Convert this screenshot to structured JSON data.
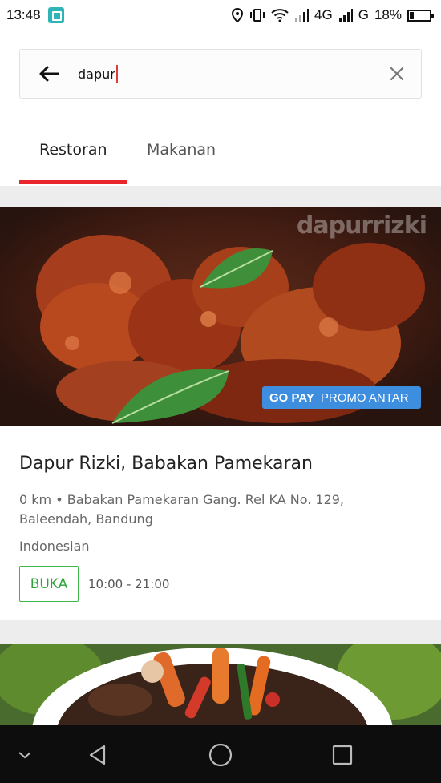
{
  "status_bar": {
    "time": "13:48",
    "network_1": "4G",
    "network_2": "G",
    "battery_percent": "18%",
    "battery_level": 0.18
  },
  "search": {
    "query": "dapur"
  },
  "tabs": [
    {
      "label": "Restoran",
      "active": true
    },
    {
      "label": "Makanan",
      "active": false
    }
  ],
  "results": [
    {
      "watermark": "dapurrizki",
      "promo_label": "PROMO ANTAR",
      "payment_brand": "GO PAY",
      "name": "Dapur Rizki, Babakan Pamekaran",
      "distance_address": "0 km • Babakan Pamekaran Gang. Rel KA No. 129, Baleendah, Bandung",
      "cuisine": "Indonesian",
      "status": "BUKA",
      "hours": "10:00 - 21:00"
    }
  ],
  "colors": {
    "accent_red": "#e8262c",
    "open_green": "#3eb54a",
    "gopay_blue": "#3e8ee0"
  },
  "icons": [
    "back-arrow-icon",
    "clear-icon",
    "location-icon",
    "vibrate-icon",
    "wifi-icon",
    "signal-icon",
    "battery-icon",
    "nav-back-icon",
    "nav-home-icon",
    "nav-recents-icon",
    "nav-collapse-icon"
  ]
}
